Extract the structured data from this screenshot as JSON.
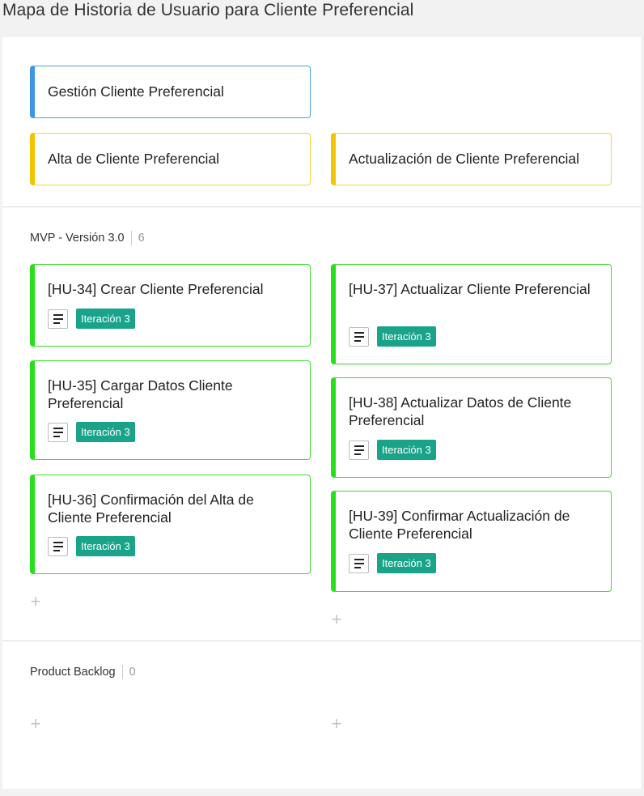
{
  "page_title": "Mapa de Historia de Usuario para Cliente Preferencial",
  "epics": [
    {
      "title": "Gestión Cliente Preferencial",
      "color": "#3d95e3"
    }
  ],
  "features": [
    {
      "title": "Alta de Cliente Preferencial",
      "color": "#f5c400"
    },
    {
      "title": "Actualización de Cliente Preferencial",
      "color": "#f5c400"
    }
  ],
  "releases": [
    {
      "name": "MVP - Versión 3.0",
      "count": "6",
      "columns": [
        [
          {
            "title": "[HU-34]  Crear Cliente Preferencial",
            "tag": "Iteración 3"
          },
          {
            "title": "[HU-35] Cargar Datos Cliente Preferencial",
            "tag": "Iteración 3"
          },
          {
            "title": "[HU-36] Confirmación del Alta de Cliente Preferencial",
            "tag": "Iteración 3"
          }
        ],
        [
          {
            "title": "[HU-37] Actualizar Cliente Preferencial",
            "tag": "Iteración 3"
          },
          {
            "title": "[HU-38] Actualizar Datos de Cliente Preferencial",
            "tag": "Iteración 3"
          },
          {
            "title": "[HU-39] Confirmar Actualización de Cliente Preferencial",
            "tag": "Iteración 3"
          }
        ]
      ]
    },
    {
      "name": "Product Backlog",
      "count": "0",
      "columns": [
        [],
        []
      ]
    }
  ],
  "add_symbol": "+",
  "colors": {
    "story_border": "#27e01a",
    "tag_background": "#19a48a"
  },
  "icons": {
    "description": "description-lines-icon",
    "add": "plus-icon"
  }
}
